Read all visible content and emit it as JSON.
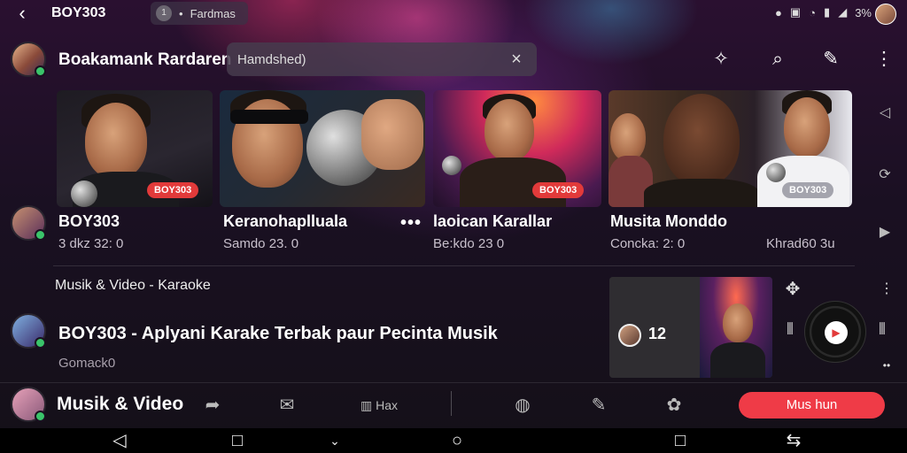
{
  "status_bar": {
    "app_title": "BOY303",
    "pill_label": "Fardmas",
    "pill_dot": "1",
    "battery": "3%"
  },
  "header": {
    "channel_name": "Boakamank Rardaren",
    "search_value": "Hamdshed)",
    "icons": [
      "share-icon",
      "search-icon",
      "pin-icon",
      "more-vert-icon"
    ]
  },
  "cards": [
    {
      "title": "BOY303",
      "sub": "3 dkz 32: 0",
      "badge": "BOY303"
    },
    {
      "title": "Keranohaplluala",
      "sub": "Samdo 23. 0",
      "badge": ""
    },
    {
      "title": "laoican Karallar",
      "sub": "Be:kdo 23 0",
      "badge": "BOY303"
    },
    {
      "title": "Musita Monddo",
      "sub": "Concka: 2: 0",
      "sub_right": "Khrad60 3u",
      "badge": "BOY303"
    }
  ],
  "more_dots": "•••",
  "section": {
    "label": "Musik & Video - Karaoke",
    "row_title": "BOY303 - Aplyani Karake Terbak paur Pecinta Musik",
    "row_sub": "Gomack0"
  },
  "mini_player": {
    "count": "12"
  },
  "bottom_bar": {
    "label": "Musik & Video",
    "item_text": "Hax",
    "cta": "Mus hun"
  },
  "colors": {
    "accent": "#ef3b47",
    "badge": "#e23a3a",
    "online": "#3ac46a"
  }
}
